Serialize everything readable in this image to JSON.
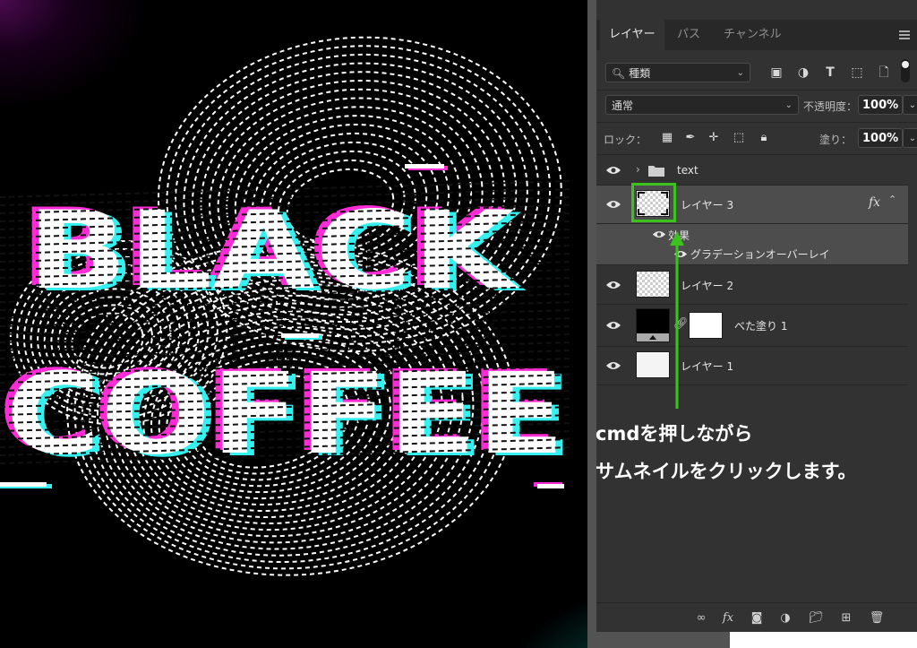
{
  "canvas": {
    "word_top": "BLACK",
    "word_bottom": "COFFEE"
  },
  "panel": {
    "tabs": [
      {
        "label": "レイヤー",
        "active": true
      },
      {
        "label": "パス",
        "active": false
      },
      {
        "label": "チャンネル",
        "active": false
      }
    ],
    "filter": {
      "kind_label": "種類"
    },
    "blend_mode": "通常",
    "opacity_label": "不透明度：",
    "opacity_value": "100%",
    "lock_label": "ロック：",
    "fill_label": "塗り：",
    "fill_value": "100%",
    "layers": [
      {
        "name": "text",
        "type": "group"
      },
      {
        "name": "レイヤー 3",
        "type": "layer",
        "selected": true,
        "fx": "fx",
        "effects_label": "効果",
        "effects": [
          "グラデーションオーバーレイ"
        ]
      },
      {
        "name": "レイヤー 2",
        "type": "layer"
      },
      {
        "name": "べた塗り 1",
        "type": "fill"
      },
      {
        "name": "レイヤー 1",
        "type": "layer"
      }
    ]
  },
  "annotation": {
    "line1": "cmdを押しながら",
    "line2": "サムネイルをクリックします。",
    "highlight_color": "#3cc21c"
  },
  "colors": {
    "glitch_magenta": "#ff2bd6",
    "glitch_cyan": "#36f0f0",
    "panel_bg": "#323232"
  }
}
